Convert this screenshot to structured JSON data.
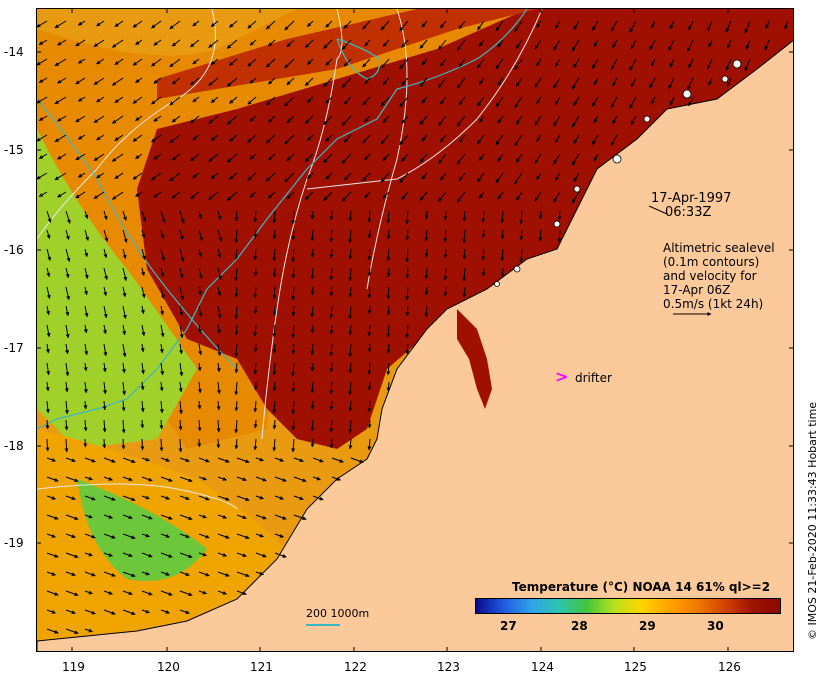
{
  "map": {
    "datetime_lines": [
      "17-Apr-1997",
      "06:33Z"
    ],
    "info_lines": [
      "Altimetric sealevel",
      "(0.1m contours)",
      "and velocity for",
      "17-Apr 06Z",
      "0.5m/s (1kt 24h)"
    ],
    "drifter_symbol": ">",
    "drifter_label": "drifter",
    "credit": "© IMOS 21-Feb-2020 11:33:43 Hobart time",
    "scale_label": "200  1000m",
    "longitude_ticks": [
      "119",
      "120",
      "121",
      "122",
      "123",
      "124",
      "125",
      "126"
    ],
    "latitude_ticks": [
      "-14",
      "-15",
      "-16",
      "-17",
      "-18",
      "-19"
    ]
  },
  "colorbar": {
    "title": "Temperature (°C) NOAA 14 61% ql>=2",
    "ticks": [
      "27",
      "28",
      "29",
      "30"
    ],
    "colors": [
      "#0a0a8c",
      "#1f5ae0",
      "#2fa3e6",
      "#2ec4b0",
      "#42c63c",
      "#b8e01e",
      "#ffd400",
      "#ffa300",
      "#f07a00",
      "#d24400",
      "#a01200",
      "#8a0a00"
    ]
  },
  "colors": {
    "land": "#fbc99a",
    "sst_warm": "#a01000",
    "contour": "#e8e8e8",
    "isobath": "#3fb6c6",
    "drifter": "#ff00ff"
  }
}
